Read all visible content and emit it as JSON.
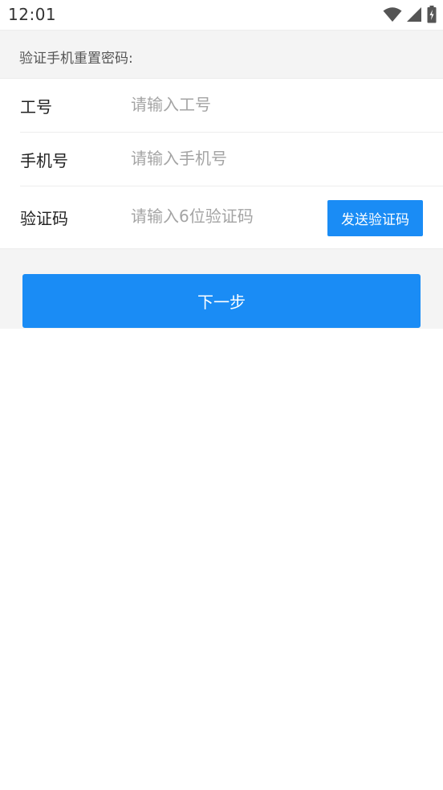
{
  "status_bar": {
    "time": "12:01",
    "icons": [
      "wifi-icon",
      "cellular-signal-icon",
      "battery-charging-icon"
    ]
  },
  "header": {
    "title": "验证手机重置密码:"
  },
  "form": {
    "employee_id": {
      "label": "工号",
      "placeholder": "请输入工号",
      "value": ""
    },
    "phone": {
      "label": "手机号",
      "placeholder": "请输入手机号",
      "value": ""
    },
    "code": {
      "label": "验证码",
      "placeholder": "请输入6位验证码",
      "value": ""
    },
    "send_code_label": "发送验证码"
  },
  "actions": {
    "next_label": "下一步"
  },
  "colors": {
    "accent": "#1a8cf5",
    "band_background": "#f4f4f4",
    "placeholder_text": "#a4a4a4"
  }
}
